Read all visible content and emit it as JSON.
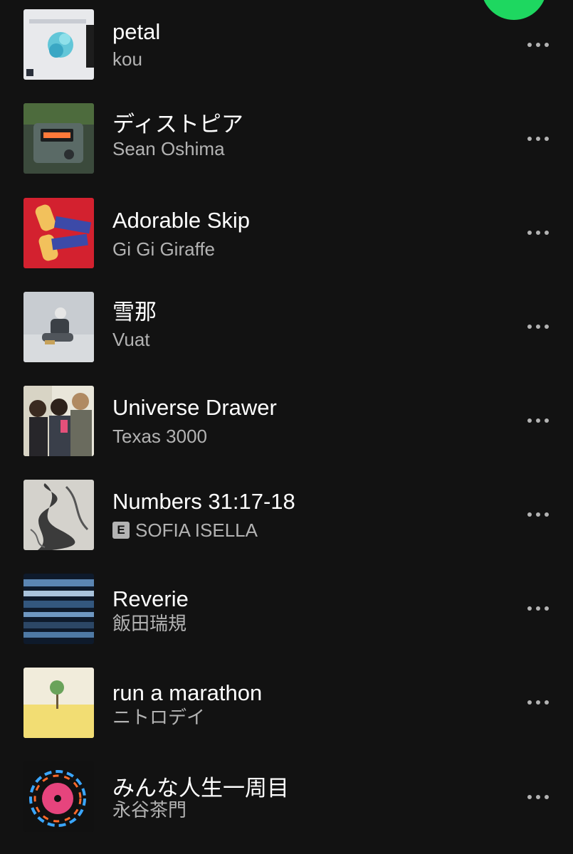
{
  "colors": {
    "background": "#121212",
    "title": "#ffffff",
    "subtitle": "#b3b3b3",
    "accent": "#1ed760"
  },
  "play_button": {
    "icon": "play-icon"
  },
  "tracks": [
    {
      "title": "petal",
      "artist": "kou",
      "explicit": false,
      "more_icon": "more-icon"
    },
    {
      "title": "ディストピア",
      "artist": "Sean Oshima",
      "explicit": false,
      "more_icon": "more-icon"
    },
    {
      "title": "Adorable Skip",
      "artist": "Gi Gi Giraffe",
      "explicit": false,
      "more_icon": "more-icon"
    },
    {
      "title": "雪那",
      "artist": "Vuat",
      "explicit": false,
      "more_icon": "more-icon"
    },
    {
      "title": "Universe Drawer",
      "artist": "Texas 3000",
      "explicit": false,
      "more_icon": "more-icon"
    },
    {
      "title": "Numbers 31:17-18",
      "artist": "SOFIA ISELLA",
      "explicit": true,
      "explicit_label": "E",
      "more_icon": "more-icon"
    },
    {
      "title": "Reverie",
      "artist": "飯田瑞規",
      "explicit": false,
      "more_icon": "more-icon"
    },
    {
      "title": "run a marathon",
      "artist": "ニトロデイ",
      "explicit": false,
      "more_icon": "more-icon"
    },
    {
      "title": "みんな人生一周目",
      "artist": "永谷茶門",
      "explicit": false,
      "more_icon": "more-icon"
    }
  ]
}
